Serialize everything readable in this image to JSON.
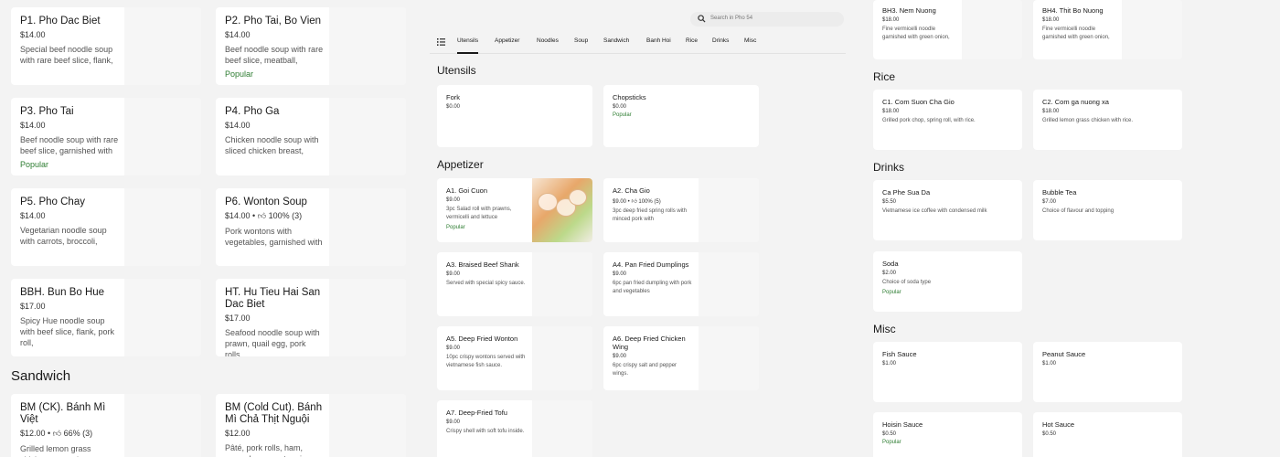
{
  "colors": {
    "popular": "#2e7d32",
    "card_bg": "#ffffff",
    "page_bg": "#f3f3f3"
  },
  "left": {
    "items": [
      {
        "name": "P1. Pho Dac Biet",
        "price": "$14.00",
        "desc": "Special beef noodle soup with rare beef slice, flank,",
        "popular": ""
      },
      {
        "name": "P2. Pho Tai, Bo Vien",
        "price": "$14.00",
        "desc": "Beef noodle soup with rare beef slice, meatball,",
        "popular": "Popular"
      },
      {
        "name": "P3. Pho Tai",
        "price": "$14.00",
        "desc": "Beef noodle soup with rare beef slice, garnished with",
        "popular": "Popular"
      },
      {
        "name": "P4. Pho Ga",
        "price": "$14.00",
        "desc": "Chicken noodle soup with sliced chicken breast,",
        "popular": ""
      },
      {
        "name": "P5. Pho Chay",
        "price": "$14.00",
        "desc": "Vegetarian noodle soup with carrots, broccoli,",
        "popular": ""
      },
      {
        "name": "P6. Wonton Soup",
        "price": "$14.00",
        "rating": "100% (3)",
        "desc": "Pork wontons with vegetables, garnished with",
        "popular": ""
      },
      {
        "name": "BBH. Bun Bo Hue",
        "price": "$17.00",
        "desc": "Spicy Hue noodle soup with beef slice, flank, pork roll,",
        "popular": ""
      },
      {
        "name": "HT. Hu Tieu Hai San Dac Biet",
        "price": "$17.00",
        "desc": "Seafood noodle soup with prawn, quail egg, pork rolls,",
        "popular": ""
      }
    ],
    "sandwich_title": "Sandwich",
    "sandwich": [
      {
        "name": "BM (CK). Bánh Mì Việt",
        "price": "$12.00",
        "rating": "66% (3)",
        "desc": "Grilled lemon grass chicken, cucumber, carrot, onion and"
      },
      {
        "name": "BM (Cold Cut). Bánh Mì Chả Thịt Nguội",
        "price": "$12.00",
        "desc": "Pâté, pork rolls, ham, cucumber, carrot, onion and"
      }
    ]
  },
  "middle": {
    "search": {
      "placeholder": "Search in Pho 54"
    },
    "tabs": [
      "Utensils",
      "Appetizer",
      "Noodles",
      "Soup",
      "Sandwich",
      "Banh Hoi",
      "Rice",
      "Drinks",
      "Misc"
    ],
    "utensils_title": "Utensils",
    "utensils": [
      {
        "name": "Fork",
        "price": "$0.00",
        "popular": ""
      },
      {
        "name": "Chopsticks",
        "price": "$0.00",
        "popular": "Popular"
      }
    ],
    "appetizer_title": "Appetizer",
    "appetizers": [
      {
        "name": "A1. Goi Cuon",
        "price": "$9.00",
        "desc": "3pc Salad roll with prawns, vermicelli and lettuce",
        "popular": "Popular"
      },
      {
        "name": "A2. Cha Gio",
        "price": "$9.00",
        "rating": "100% (5)",
        "desc": "3pc deep fried spring rolls with minced pork with",
        "popular": ""
      },
      {
        "name": "A3. Braised Beef Shank",
        "price": "$9.00",
        "desc": "Served with special spicy sauce.",
        "popular": ""
      },
      {
        "name": "A4. Pan Fried Dumplings",
        "price": "$9.00",
        "desc": "6pc pan fried dumpling with pork and vegetables",
        "popular": ""
      },
      {
        "name": "A5. Deep Fried Wonton",
        "price": "$9.00",
        "desc": "10pc crispy wontons served with vietnamese fish sauce.",
        "popular": ""
      },
      {
        "name": "A6. Deep Fried Chicken Wing",
        "price": "$9.00",
        "desc": "6pc crispy salt and pepper wings.",
        "popular": ""
      },
      {
        "name": "A7. Deep-Fried Tofu",
        "price": "$9.00",
        "desc": "Crispy shell with soft tofu inside.",
        "popular": ""
      }
    ]
  },
  "right": {
    "banhhoi": [
      {
        "name": "BH3. Nem Nuong",
        "price": "$18.00",
        "desc": "Fine vermicelli noodle garnished with green onion,"
      },
      {
        "name": "BH4. Thit Bo Nuong",
        "price": "$18.00",
        "desc": "Fine vermicelli noodle garnished with green onion,"
      }
    ],
    "rice_title": "Rice",
    "rice": [
      {
        "name": "C1. Com Suon Cha Gio",
        "price": "$18.00",
        "desc": "Grilled pork chop, spring roll, with rice."
      },
      {
        "name": "C2. Com ga nuong xa",
        "price": "$18.00",
        "desc": "Grilled lemon grass chicken with rice."
      }
    ],
    "drinks_title": "Drinks",
    "drinks": [
      {
        "name": "Ca Phe Sua Da",
        "price": "$5.50",
        "desc": "Vietnamese ice coffee with condensed milk",
        "popular": ""
      },
      {
        "name": "Bubble Tea",
        "price": "$7.00",
        "desc": "Choice of flavour and topping",
        "popular": ""
      },
      {
        "name": "Soda",
        "price": "$2.00",
        "desc": "Choice of soda type",
        "popular": "Popular"
      }
    ],
    "misc_title": "Misc",
    "misc": [
      {
        "name": "Fish Sauce",
        "price": "$1.00",
        "popular": ""
      },
      {
        "name": "Peanut Sauce",
        "price": "$1.00",
        "popular": ""
      },
      {
        "name": "Hoisin Sauce",
        "price": "$0.50",
        "popular": "Popular"
      },
      {
        "name": "Hot Sauce",
        "price": "$0.50",
        "popular": ""
      }
    ]
  }
}
